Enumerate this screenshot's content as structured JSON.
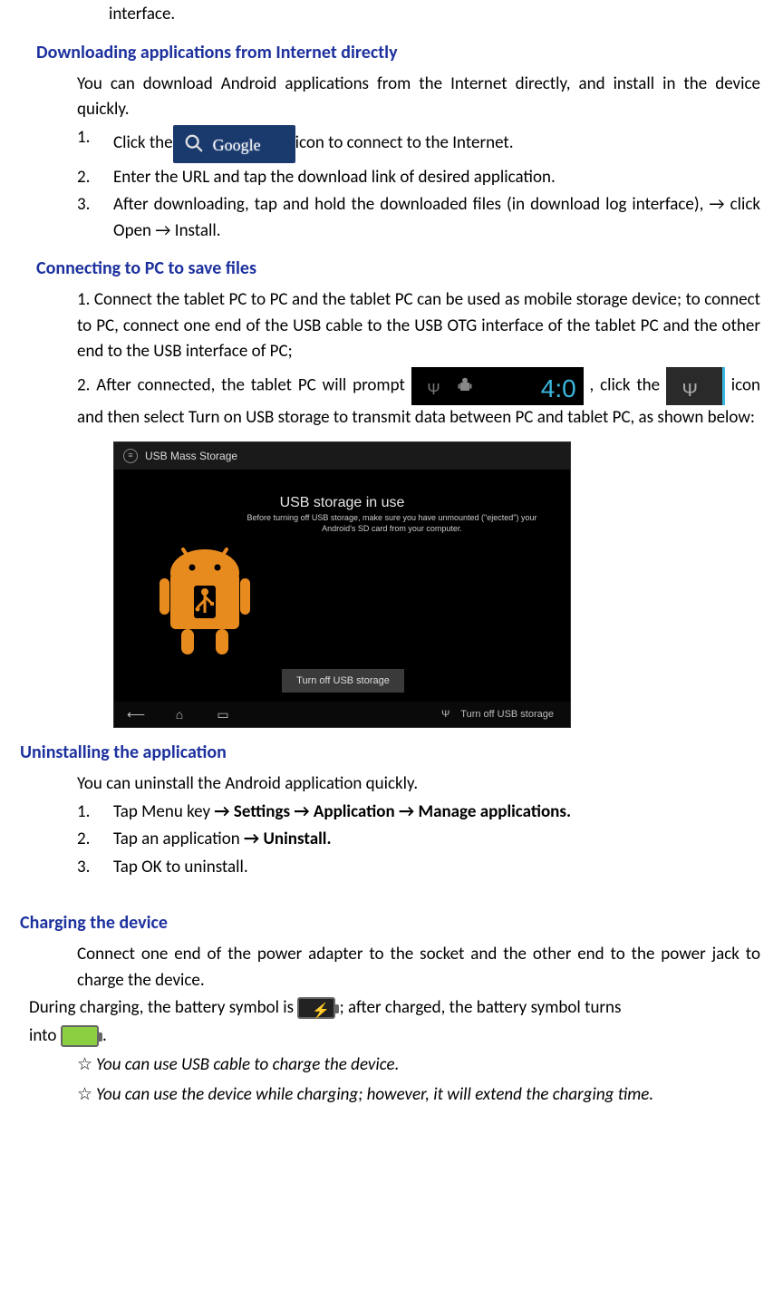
{
  "topFragment": "interface.",
  "sections": {
    "download": {
      "heading": "Downloading applications from Internet directly",
      "intro": "You can download Android applications from the Internet directly, and install in the device quickly.",
      "step1_a": "Click the",
      "step1_b": " icon to connect to the Internet.",
      "step2": "Enter the URL and tap the download link of desired application.",
      "step3": "After downloading, tap and hold the downloaded files (in download log interface), → click Open → Install.",
      "googleLabel": "Google"
    },
    "connectpc": {
      "heading": "Connecting to PC to save files",
      "para1": "1. Connect the tablet PC to PC and the tablet PC can be used as mobile storage device; to connect to PC, connect one end of the USB cable to the USB OTG interface of the tablet PC and the other end to the USB interface of PC;",
      "para2_a": "2. After connected, the tablet PC will prompt",
      "para2_b": ", click the ",
      "para2_c": "icon and then select Turn on USB storage to transmit data between PC and tablet PC, as shown below:",
      "statusTime": "4:0",
      "screenshot": {
        "topbar": "USB Mass Storage",
        "title": "USB storage in use",
        "subtitle": "Before turning off USB storage, make sure you have unmounted (\"ejected\") your Android's SD card from your computer.",
        "button": "Turn off USB storage",
        "navButton": "Turn off USB storage"
      }
    },
    "uninstall": {
      "heading": "Uninstalling the application",
      "intro": "You can uninstall the Android application quickly.",
      "step1_a": "Tap Menu key ",
      "step1_b": "→ Settings → Application → Manage applications.",
      "step2_a": "Tap an application ",
      "step2_b": "→ Uninstall.",
      "step3": "Tap OK to uninstall."
    },
    "charging": {
      "heading": "Charging the device",
      "intro": "Connect one end of the power adapter to the socket and the other end to the power jack to charge the device.",
      "during_a": "During charging, the battery symbol is",
      "during_b": "; after charged, the battery symbol turns",
      "into_a": "into",
      "into_b": ".",
      "note1": "You can use USB cable to charge the device.",
      "note2": "You can use the device while charging; however, it will extend the charging time."
    }
  }
}
